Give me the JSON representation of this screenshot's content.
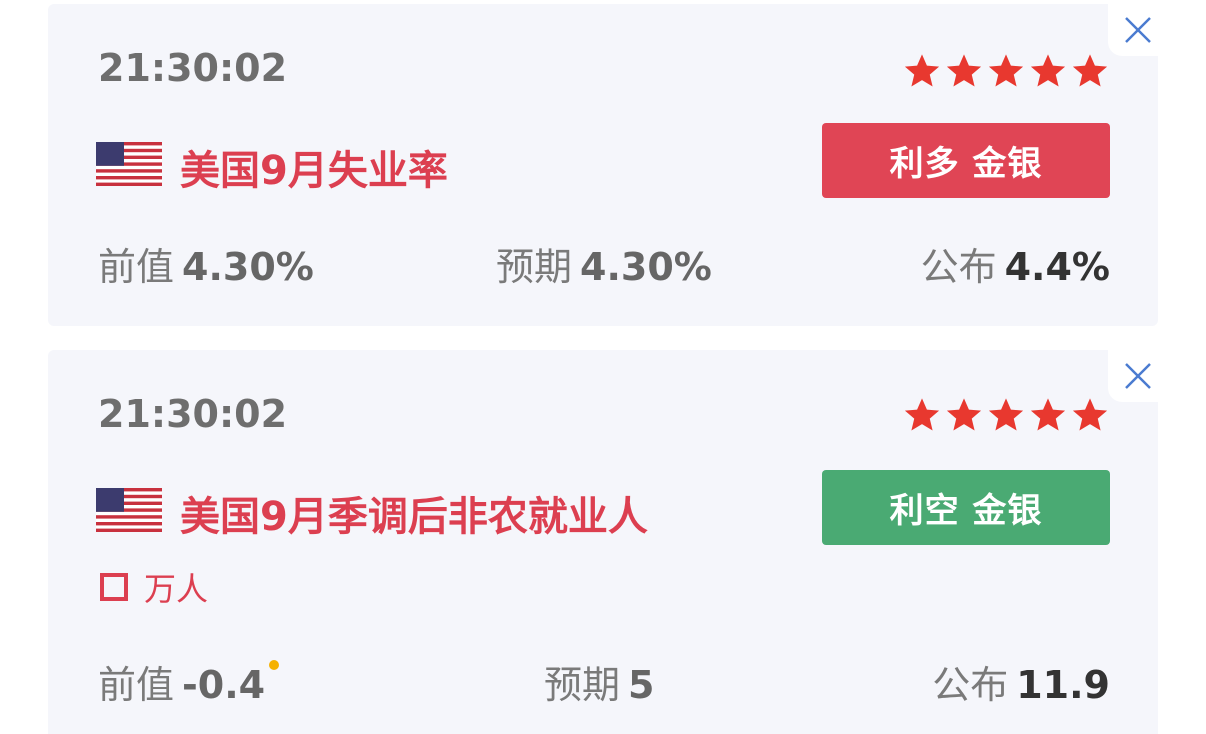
{
  "events": [
    {
      "time": "21:30:02",
      "stars": 5,
      "country_flag": "us-flag",
      "title": "美国9月失业率",
      "impact": {
        "label": "利多 金银",
        "type": "bullish",
        "color": "#e04555"
      },
      "stats": {
        "previous_label": "前值",
        "previous_value": "4.30%",
        "forecast_label": "预期",
        "forecast_value": "4.30%",
        "actual_label": "公布",
        "actual_value": "4.4%"
      }
    },
    {
      "time": "21:30:02",
      "stars": 5,
      "country_flag": "us-flag",
      "title": "美国9月季调后非农就业人",
      "unit": "万人",
      "impact": {
        "label": "利空 金银",
        "type": "bearish",
        "color": "#4aaa73"
      },
      "stats": {
        "previous_label": "前值",
        "previous_value": "-0.4",
        "forecast_label": "预期",
        "forecast_value": "5",
        "actual_label": "公布",
        "actual_value": "11.9"
      }
    }
  ],
  "colors": {
    "title": "#dc3f50",
    "star": "#e8382f",
    "close": "#4a7bd0",
    "revised_dot": "#f5b100"
  },
  "icons": {
    "close": "close-icon",
    "star": "star-icon",
    "unit_marker": "square-outline-icon"
  }
}
